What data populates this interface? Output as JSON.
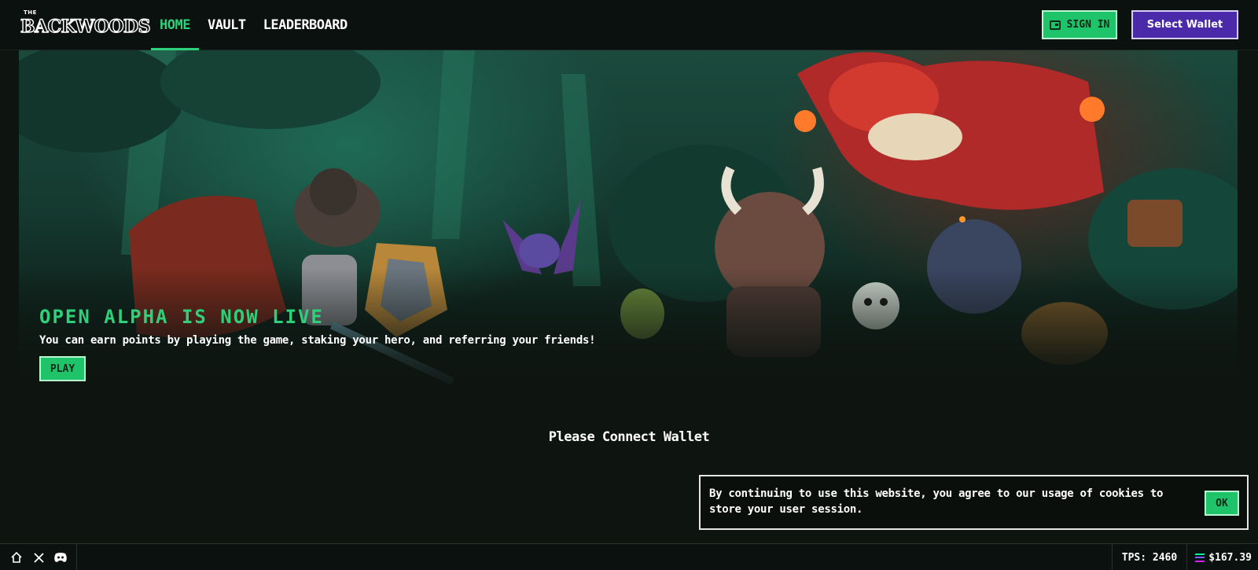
{
  "header": {
    "logo_small": "THE",
    "logo_main": "BACKWOODS",
    "nav": [
      {
        "label": "HOME",
        "active": true
      },
      {
        "label": "VAULT",
        "active": false
      },
      {
        "label": "LEADERBOARD",
        "active": false
      }
    ],
    "sign_in_label": "SIGN IN",
    "sign_in_icon": "wallet-icon",
    "select_wallet_label": "Select Wallet"
  },
  "hero": {
    "title": "OPEN ALPHA IS NOW LIVE",
    "subtitle": "You can earn points by playing the game, staking your hero, and referring your friends!",
    "play_label": "PLAY"
  },
  "main": {
    "connect_message": "Please Connect Wallet"
  },
  "cookie_banner": {
    "text": "By continuing to use this website, you agree to our usage of cookies to store your user session.",
    "ok_label": "OK"
  },
  "footer": {
    "icons": [
      "home-icon",
      "x-twitter-icon",
      "discord-icon"
    ],
    "tps": "TPS: 2460",
    "price_icon": "solana-icon",
    "price": "$167.39"
  },
  "colors": {
    "accent_green": "#2fd07a",
    "button_green": "#1fc46a",
    "wallet_purple": "#4a2aa8",
    "background": "#0e1511"
  }
}
